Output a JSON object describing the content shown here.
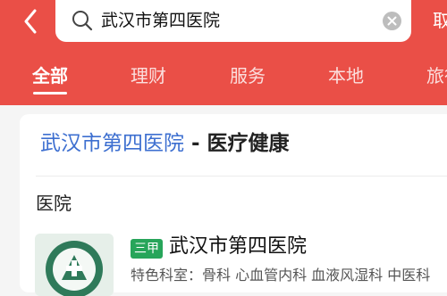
{
  "header": {
    "search_value": "武汉市第四医院",
    "cancel_label": "取消",
    "colors": {
      "accent": "#ea4f47",
      "search_bg": "#ffffff"
    }
  },
  "tabs": [
    {
      "label": "全部",
      "active": true
    },
    {
      "label": "理财",
      "active": false
    },
    {
      "label": "服务",
      "active": false
    },
    {
      "label": "本地",
      "active": false
    },
    {
      "label": "旅行",
      "active": false
    }
  ],
  "result_card": {
    "title_name": "武汉市第四医院",
    "title_suffix": " - 医疗健康",
    "section_label": "医院",
    "hospital": {
      "badge": "三甲",
      "name": "武汉市第四医院",
      "departments": "特色科室：骨科 心血管内科 血液风湿科 中医科",
      "logo_icon": "hospital-emblem-icon"
    },
    "colors": {
      "link": "#3d6fd0",
      "badge": "#27a55a"
    }
  }
}
